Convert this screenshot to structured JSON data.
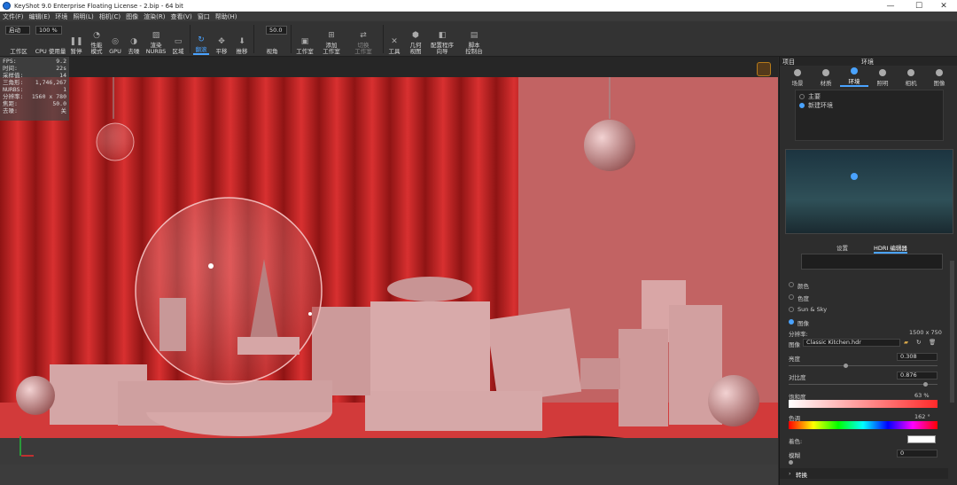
{
  "window": {
    "title": "KeyShot 9.0 Enterprise Floating License  - 2.bip  - 64 bit",
    "min": "—",
    "max": "☐",
    "close": "✕"
  },
  "menu": [
    "文件(F)",
    "编辑(E)",
    "环境",
    "照明(L)",
    "相机(C)",
    "图像",
    "渲染(R)",
    "查看(V)",
    "窗口",
    "帮助(H)"
  ],
  "toolbar": {
    "workspace_select": "启动",
    "workspace_label": "工作区",
    "cpu_value": "100 %",
    "cpu_label": "CPU 使用量",
    "pause": "暂停",
    "perf_line1": "性能",
    "perf_line2": "模式",
    "gpu": "GPU",
    "denoise": "去噪",
    "nurbs_line1": "渲染",
    "nurbs_line2": "NURBS",
    "region": "区域",
    "tumble": "翻滚",
    "pan": "平移",
    "dolly": "推移",
    "fov_value": "50.0",
    "view": "视角",
    "studio": "工作室",
    "add_line1": "添加",
    "add_line2": "工作室",
    "switch_line1": "切换",
    "switch_line2": "工作室",
    "tools": "工具",
    "geo_line1": "几何",
    "geo_line2": "视图",
    "cfg_line1": "配置程序",
    "cfg_line2": "向导",
    "script_line1": "脚本",
    "script_line2": "控制台"
  },
  "hud": [
    {
      "k": "FPS:",
      "v": "9.2"
    },
    {
      "k": "时间:",
      "v": "22s"
    },
    {
      "k": "采样值:",
      "v": "14"
    },
    {
      "k": "三角形:",
      "v": "1,746,267"
    },
    {
      "k": "NURBS:",
      "v": "1"
    },
    {
      "k": "分辨率:",
      "v": "1560 x 780"
    },
    {
      "k": "焦距:",
      "v": "50.0"
    },
    {
      "k": "去噪:",
      "v": "关"
    }
  ],
  "panel": {
    "left_title": "项目",
    "center_title": "环境",
    "tabs": [
      "场景",
      "材质",
      "环境",
      "照明",
      "相机",
      "图像"
    ],
    "env_list": [
      "主要",
      "新建环境"
    ],
    "subtabs": [
      "设置",
      "HDRI 编辑器"
    ],
    "bg_options": [
      "颜色",
      "色度",
      "Sun & Sky",
      "图像"
    ],
    "resolution_label": "分辨率:",
    "resolution_value": "1500 x 750",
    "image_label": "图像",
    "image_value": "Classic Kitchen.hdr",
    "brightness_label": "亮度",
    "brightness_value": "0.308",
    "brightness_level": 0.31,
    "contrast_label": "对比度",
    "contrast_value": "0.876",
    "contrast_level": 0.88,
    "saturation_label": "饱和度",
    "saturation_value": "63 %",
    "hue_label": "色调",
    "hue_value": "162 °",
    "tint_label": "着色:",
    "blur_label": "模糊",
    "blur_value": "0",
    "transform_label": "转换"
  },
  "colors": {
    "accent": "#4aa3ff",
    "scene_red": "#c42a2e",
    "wall_pink": "#d07070"
  }
}
